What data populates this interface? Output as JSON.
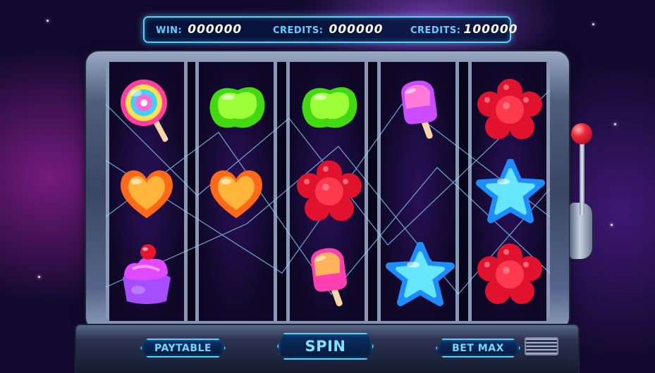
{
  "info_bar": {
    "win_label": "WIN:",
    "win_value": "000000",
    "credits_label": "CREDITS:",
    "credits_value": "000000",
    "credits2_label": "CREDITS:",
    "credits2_value": "100000"
  },
  "reels": [
    [
      "lollipop",
      "heart-candy",
      "cupcake"
    ],
    [
      "green-jelly",
      "heart-candy"
    ],
    [
      "green-jelly",
      "red-gummy-flower",
      "popsicle"
    ],
    [
      "popsicle",
      "blue-star-jelly"
    ],
    [
      "red-gummy-flower",
      "blue-star-jelly",
      "red-gummy-flower"
    ]
  ],
  "buttons": {
    "paytable": "PAYTABLE",
    "spin": "SPIN",
    "bet_max": "BET MAX"
  },
  "colors": {
    "accent": "#4fd4ff",
    "background": "#120a2e",
    "lever_knob": "#f0263a"
  }
}
